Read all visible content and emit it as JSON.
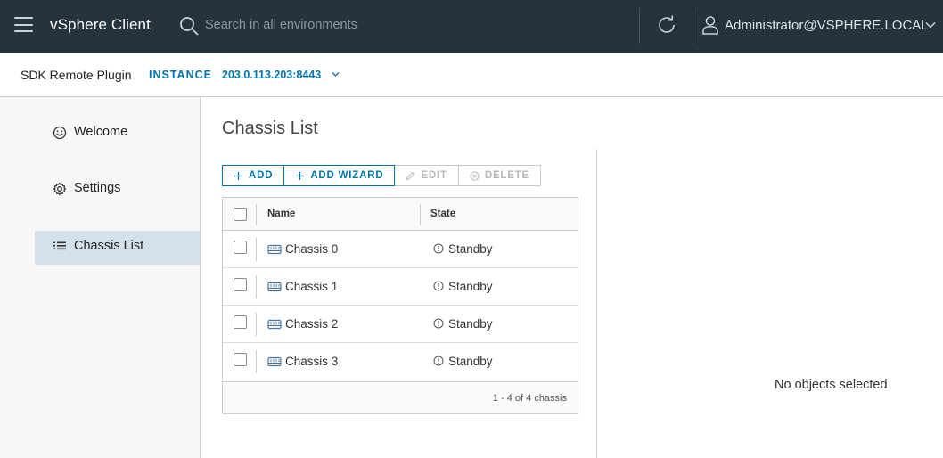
{
  "header": {
    "app_title": "vSphere Client",
    "search_placeholder": "Search in all environments",
    "user": "Administrator@VSPHERE.LOCAL"
  },
  "subheader": {
    "plugin_name": "SDK Remote Plugin",
    "instance_label": "INSTANCE",
    "instance_value": "203.0.113.203:8443"
  },
  "sidenav": {
    "items": [
      {
        "label": "Welcome",
        "icon": "smiley-icon",
        "active": false
      },
      {
        "label": "Settings",
        "icon": "gear-icon",
        "active": false
      },
      {
        "label": "Chassis List",
        "icon": "list-icon",
        "active": true
      }
    ]
  },
  "main": {
    "title": "Chassis List",
    "toolbar": {
      "add": "ADD",
      "add_wizard": "ADD WIZARD",
      "edit": "EDIT",
      "delete": "DELETE"
    },
    "grid": {
      "columns": [
        "Name",
        "State"
      ],
      "rows": [
        {
          "name": "Chassis 0",
          "state": "Standby"
        },
        {
          "name": "Chassis 1",
          "state": "Standby"
        },
        {
          "name": "Chassis 2",
          "state": "Standby"
        },
        {
          "name": "Chassis 3",
          "state": "Standby"
        }
      ],
      "footer": "1 - 4 of 4 chassis"
    },
    "detail_empty": "No objects selected"
  },
  "colors": {
    "header_bg": "#25333d",
    "accent": "#0073a8",
    "active_nav": "#d4e1ea"
  }
}
